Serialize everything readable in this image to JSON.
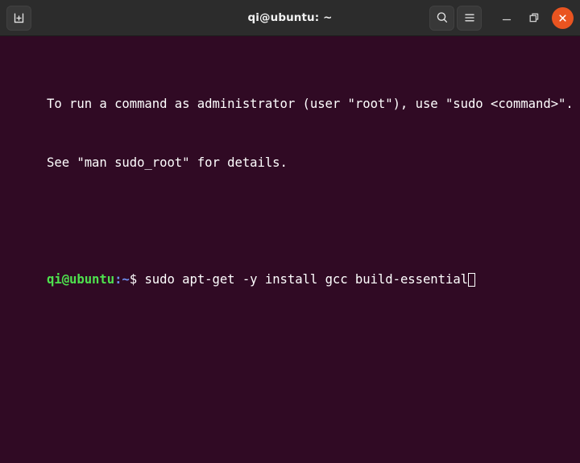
{
  "window": {
    "title": "qi@ubuntu: ~",
    "background_color": "#300a24",
    "titlebar_color": "#2c2c2c",
    "accent_color": "#e95420"
  },
  "titlebar": {
    "new_tab_label": "new-tab",
    "search_label": "search",
    "menu_label": "menu",
    "minimize_label": "minimize",
    "maximize_label": "restore",
    "close_label": "close"
  },
  "terminal": {
    "lines": [
      {
        "type": "output",
        "text": "To run a command as administrator (user \"root\"), use \"sudo <command>\"."
      },
      {
        "type": "output",
        "text": "See \"man sudo_root\" for details."
      },
      {
        "type": "blank",
        "text": " "
      },
      {
        "type": "prompt",
        "user": "qi@ubuntu",
        "path": ":~",
        "dollar": "$",
        "command": " sudo apt-get -y install gcc build-essential",
        "cursor": true
      }
    ],
    "colors": {
      "background": "#300a24",
      "foreground": "#ffffff",
      "prompt_user": "#4ee24e",
      "prompt_path": "#6d8df0",
      "cursor": "#ffffff"
    }
  }
}
